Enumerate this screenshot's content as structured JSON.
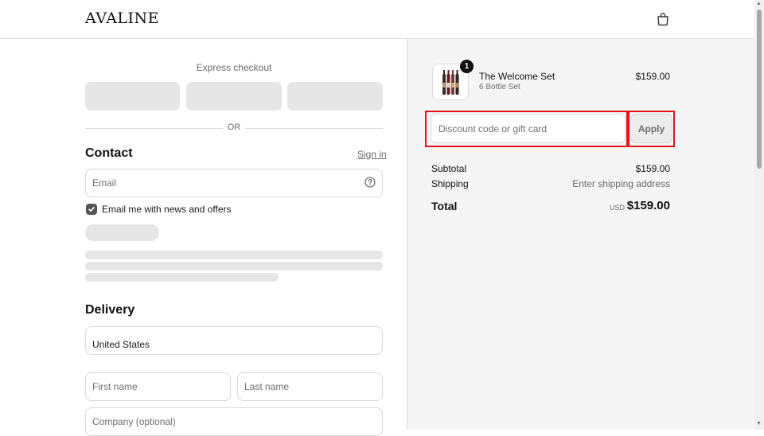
{
  "header": {
    "logo": "AVALINE",
    "cart_icon": "shopping-bag-icon"
  },
  "express": {
    "title": "Express checkout",
    "divider": "OR"
  },
  "contact": {
    "title": "Contact",
    "signin": "Sign in",
    "email_placeholder": "Email",
    "help_icon": "question-circle-icon",
    "newsletter_label": "Email me with news and offers",
    "newsletter_checked": true
  },
  "delivery": {
    "title": "Delivery",
    "country": "United States",
    "first_name_placeholder": "First name",
    "last_name_placeholder": "Last name",
    "company_placeholder": "Company (optional)"
  },
  "summary": {
    "product": {
      "name": "The Welcome Set",
      "variant": "6 Bottle Set",
      "price": "$159.00",
      "quantity": "1"
    },
    "discount_placeholder": "Discount code or gift card",
    "apply_label": "Apply",
    "subtotal_label": "Subtotal",
    "subtotal_value": "$159.00",
    "shipping_label": "Shipping",
    "shipping_value": "Enter shipping address",
    "total_label": "Total",
    "total_currency": "USD",
    "total_value": "$159.00"
  },
  "colors": {
    "highlight": "#e0161a",
    "checkbox": "#555555"
  }
}
